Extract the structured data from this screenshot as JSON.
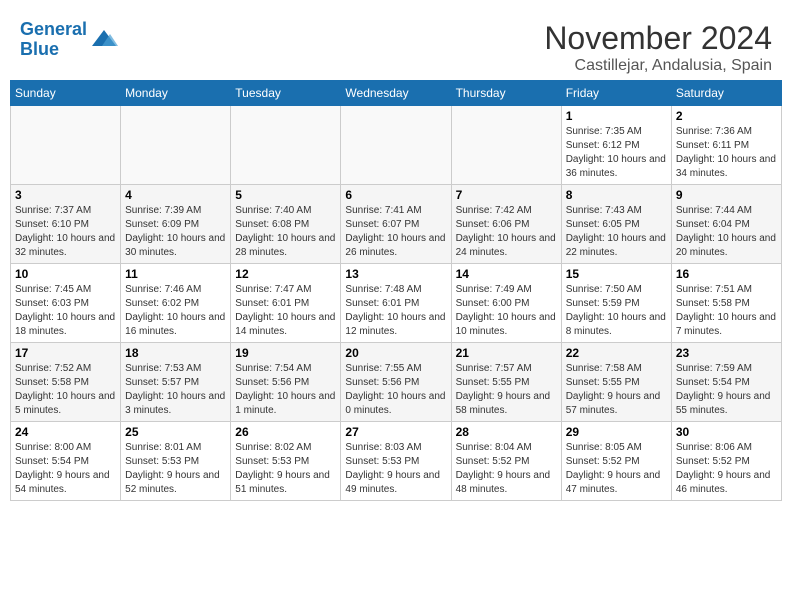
{
  "header": {
    "logo_line1": "General",
    "logo_line2": "Blue",
    "month": "November 2024",
    "location": "Castillejar, Andalusia, Spain"
  },
  "weekdays": [
    "Sunday",
    "Monday",
    "Tuesday",
    "Wednesday",
    "Thursday",
    "Friday",
    "Saturday"
  ],
  "weeks": [
    [
      {
        "day": "",
        "info": ""
      },
      {
        "day": "",
        "info": ""
      },
      {
        "day": "",
        "info": ""
      },
      {
        "day": "",
        "info": ""
      },
      {
        "day": "",
        "info": ""
      },
      {
        "day": "1",
        "info": "Sunrise: 7:35 AM\nSunset: 6:12 PM\nDaylight: 10 hours and 36 minutes."
      },
      {
        "day": "2",
        "info": "Sunrise: 7:36 AM\nSunset: 6:11 PM\nDaylight: 10 hours and 34 minutes."
      }
    ],
    [
      {
        "day": "3",
        "info": "Sunrise: 7:37 AM\nSunset: 6:10 PM\nDaylight: 10 hours and 32 minutes."
      },
      {
        "day": "4",
        "info": "Sunrise: 7:39 AM\nSunset: 6:09 PM\nDaylight: 10 hours and 30 minutes."
      },
      {
        "day": "5",
        "info": "Sunrise: 7:40 AM\nSunset: 6:08 PM\nDaylight: 10 hours and 28 minutes."
      },
      {
        "day": "6",
        "info": "Sunrise: 7:41 AM\nSunset: 6:07 PM\nDaylight: 10 hours and 26 minutes."
      },
      {
        "day": "7",
        "info": "Sunrise: 7:42 AM\nSunset: 6:06 PM\nDaylight: 10 hours and 24 minutes."
      },
      {
        "day": "8",
        "info": "Sunrise: 7:43 AM\nSunset: 6:05 PM\nDaylight: 10 hours and 22 minutes."
      },
      {
        "day": "9",
        "info": "Sunrise: 7:44 AM\nSunset: 6:04 PM\nDaylight: 10 hours and 20 minutes."
      }
    ],
    [
      {
        "day": "10",
        "info": "Sunrise: 7:45 AM\nSunset: 6:03 PM\nDaylight: 10 hours and 18 minutes."
      },
      {
        "day": "11",
        "info": "Sunrise: 7:46 AM\nSunset: 6:02 PM\nDaylight: 10 hours and 16 minutes."
      },
      {
        "day": "12",
        "info": "Sunrise: 7:47 AM\nSunset: 6:01 PM\nDaylight: 10 hours and 14 minutes."
      },
      {
        "day": "13",
        "info": "Sunrise: 7:48 AM\nSunset: 6:01 PM\nDaylight: 10 hours and 12 minutes."
      },
      {
        "day": "14",
        "info": "Sunrise: 7:49 AM\nSunset: 6:00 PM\nDaylight: 10 hours and 10 minutes."
      },
      {
        "day": "15",
        "info": "Sunrise: 7:50 AM\nSunset: 5:59 PM\nDaylight: 10 hours and 8 minutes."
      },
      {
        "day": "16",
        "info": "Sunrise: 7:51 AM\nSunset: 5:58 PM\nDaylight: 10 hours and 7 minutes."
      }
    ],
    [
      {
        "day": "17",
        "info": "Sunrise: 7:52 AM\nSunset: 5:58 PM\nDaylight: 10 hours and 5 minutes."
      },
      {
        "day": "18",
        "info": "Sunrise: 7:53 AM\nSunset: 5:57 PM\nDaylight: 10 hours and 3 minutes."
      },
      {
        "day": "19",
        "info": "Sunrise: 7:54 AM\nSunset: 5:56 PM\nDaylight: 10 hours and 1 minute."
      },
      {
        "day": "20",
        "info": "Sunrise: 7:55 AM\nSunset: 5:56 PM\nDaylight: 10 hours and 0 minutes."
      },
      {
        "day": "21",
        "info": "Sunrise: 7:57 AM\nSunset: 5:55 PM\nDaylight: 9 hours and 58 minutes."
      },
      {
        "day": "22",
        "info": "Sunrise: 7:58 AM\nSunset: 5:55 PM\nDaylight: 9 hours and 57 minutes."
      },
      {
        "day": "23",
        "info": "Sunrise: 7:59 AM\nSunset: 5:54 PM\nDaylight: 9 hours and 55 minutes."
      }
    ],
    [
      {
        "day": "24",
        "info": "Sunrise: 8:00 AM\nSunset: 5:54 PM\nDaylight: 9 hours and 54 minutes."
      },
      {
        "day": "25",
        "info": "Sunrise: 8:01 AM\nSunset: 5:53 PM\nDaylight: 9 hours and 52 minutes."
      },
      {
        "day": "26",
        "info": "Sunrise: 8:02 AM\nSunset: 5:53 PM\nDaylight: 9 hours and 51 minutes."
      },
      {
        "day": "27",
        "info": "Sunrise: 8:03 AM\nSunset: 5:53 PM\nDaylight: 9 hours and 49 minutes."
      },
      {
        "day": "28",
        "info": "Sunrise: 8:04 AM\nSunset: 5:52 PM\nDaylight: 9 hours and 48 minutes."
      },
      {
        "day": "29",
        "info": "Sunrise: 8:05 AM\nSunset: 5:52 PM\nDaylight: 9 hours and 47 minutes."
      },
      {
        "day": "30",
        "info": "Sunrise: 8:06 AM\nSunset: 5:52 PM\nDaylight: 9 hours and 46 minutes."
      }
    ]
  ]
}
